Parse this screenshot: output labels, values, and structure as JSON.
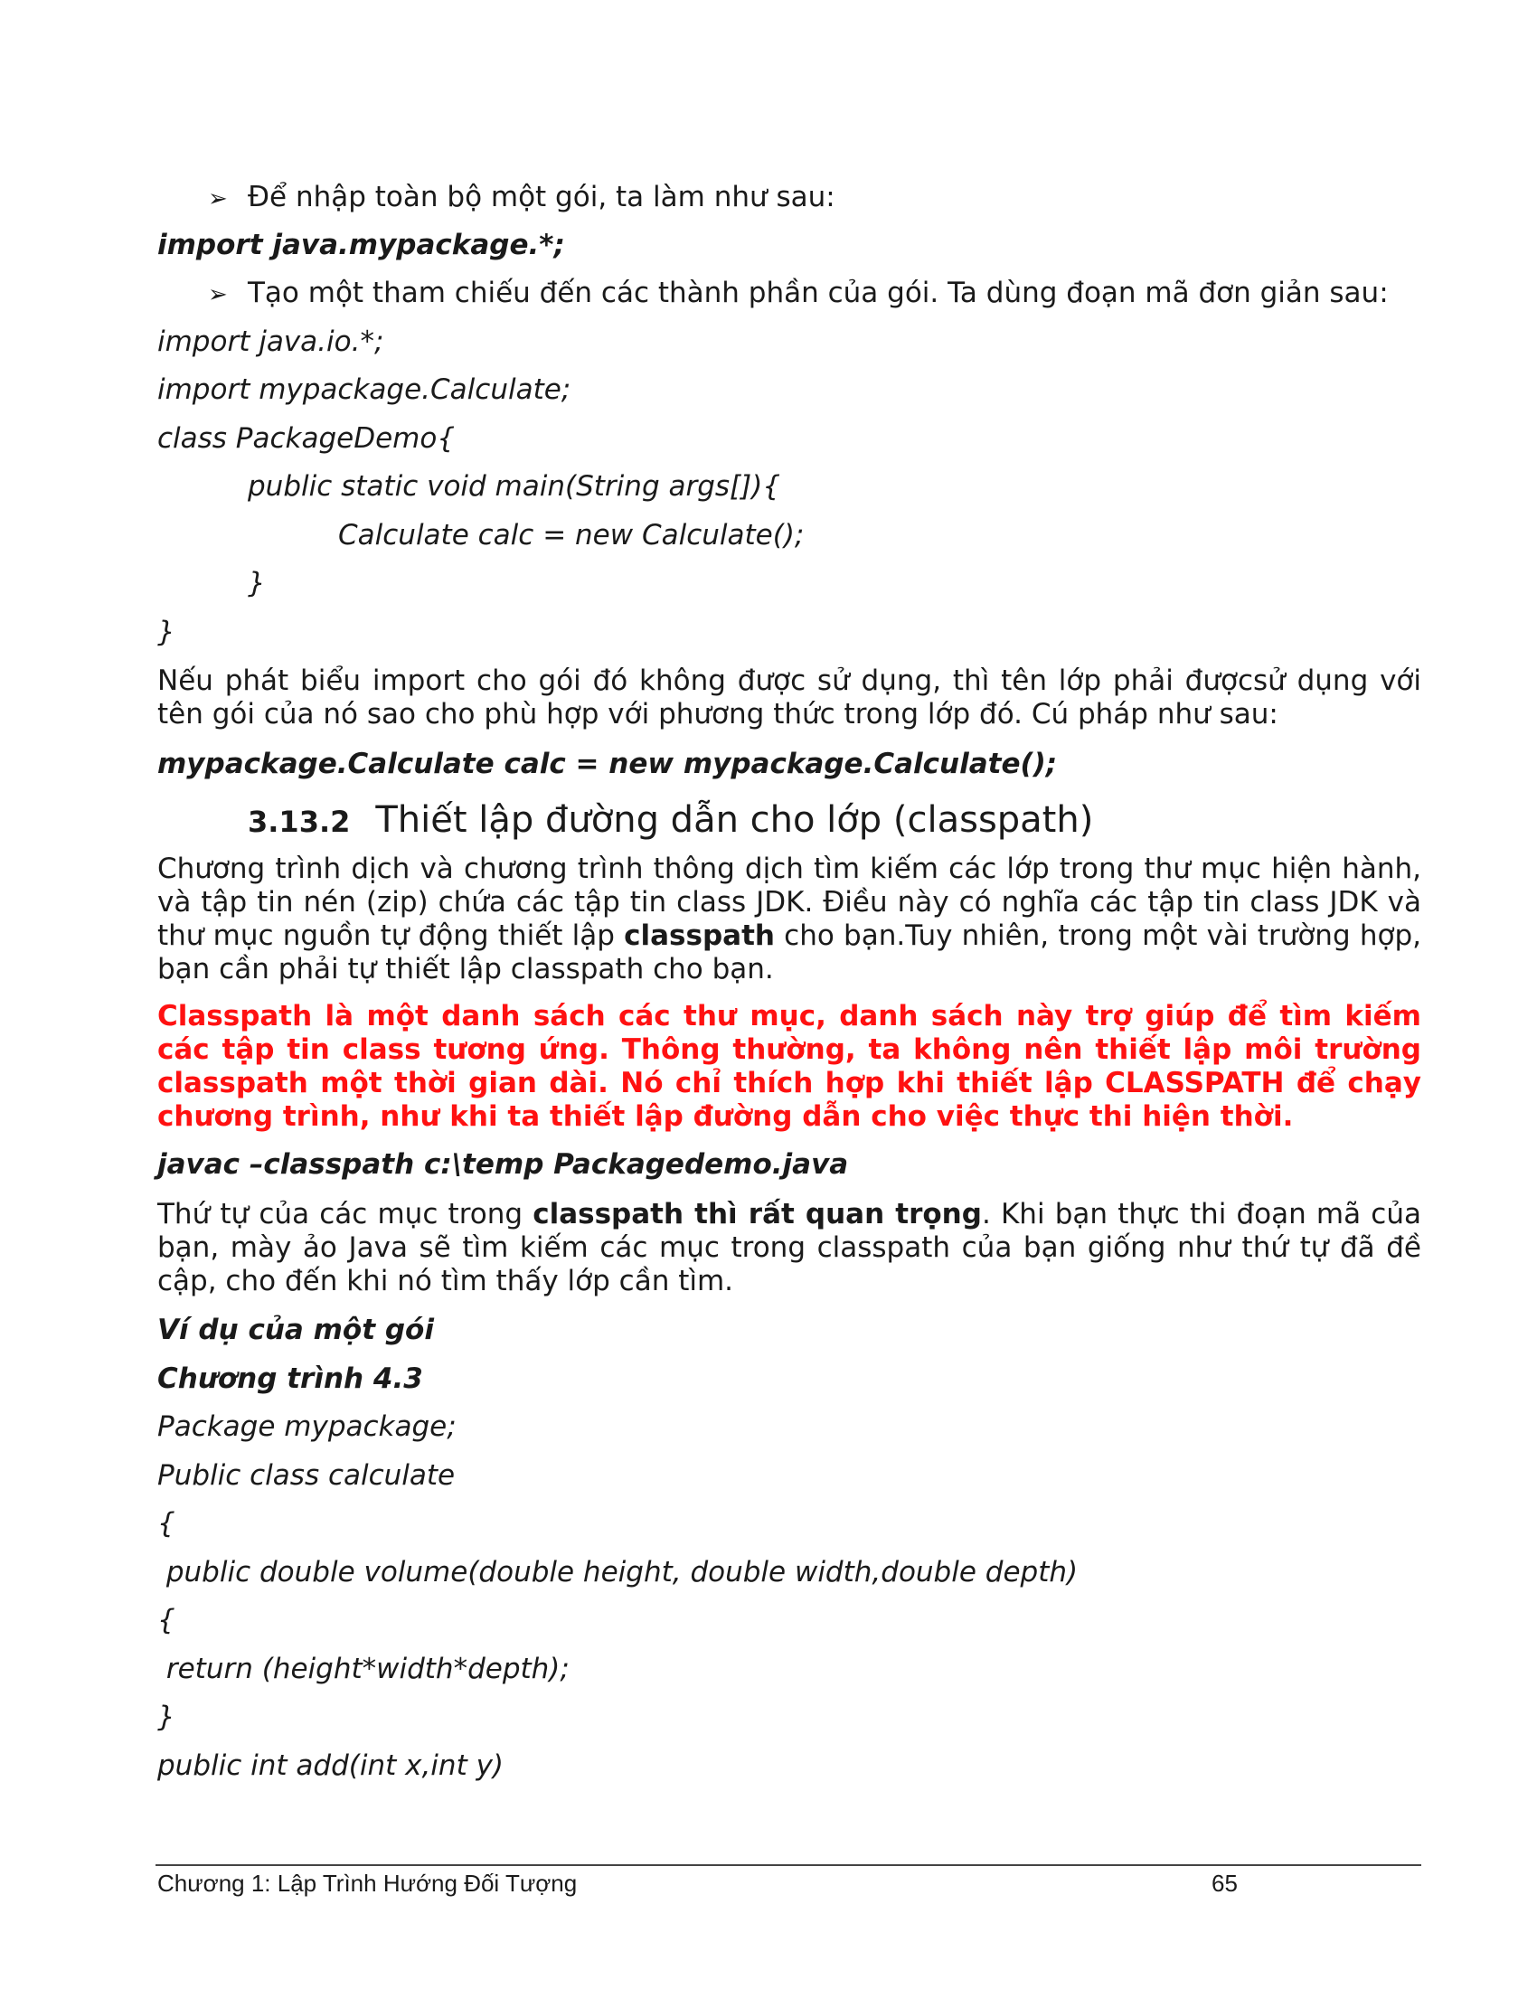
{
  "bullets": {
    "b1": "Để nhập toàn bộ một gói, ta làm như sau:",
    "b2": "Tạo một tham chiếu đến các thành phần của gói. Ta dùng đoạn mã đơn giản sau:",
    "marker": "➢"
  },
  "code1": {
    "import_all": "import java.mypackage.*;",
    "l1": "import java.io.*;",
    "l2": "import mypackage.Calculate;",
    "l3": "class PackageDemo{",
    "l4": "public static void main(String args[]){",
    "l5": "Calculate calc = new Calculate();",
    "l6": "}",
    "l7": "}"
  },
  "para1": "Nếu phát biểu import cho gói đó không được sử dụng, thì tên lớp phải đượcsử dụng với tên gói của nó sao cho phù hợp với phương thức trong lớp đó. Cú pháp như sau:",
  "syntax": "mypackage.Calculate calc = new mypackage.Calculate();",
  "heading": {
    "number": "3.13.2",
    "title": "Thiết lập đường dẫn cho lớp (classpath)"
  },
  "para2": {
    "before": "Chương trình dịch và chương trình thông dịch tìm kiếm các lớp trong thư mục hiện hành, và tập tin nén (zip)  chứa các tập tin class JDK. Điều này có nghĩa các tập tin class JDK và thư mục nguồn tự động thiết lập ",
    "bold": "classpath",
    "after": " cho bạn.Tuy nhiên, trong một vài trường hợp, bạn cần phải tự thiết lập classpath cho bạn."
  },
  "red_para": "Classpath là một danh sách các thư mục, danh sách này trợ giúp để tìm kiếm các tập tin class tương ứng. Thông thường, ta không nên thiết lập môi trường classpath  một thời gian dài. Nó chỉ thích hợp khi thiết lập CLASSPATH để chạy chương trình, như khi ta thiết lập đường dẫn cho việc thực thi hiện thời.",
  "javac_cmd": "javac –classpath   c:\\temp  Packagedemo.java",
  "para3": {
    "before": "Thứ tự của các mục trong ",
    "bold": "classpath thì rất quan trọng",
    "after": ". Khi bạn thực thi đoạn mã của bạn, mày ảo Java sẽ tìm kiếm các mục trong classpath của bạn giống như thứ tự đã đề cập, cho đến khi nó tìm thấy lớp cần tìm."
  },
  "example_title": "Ví dụ của một gói",
  "program_title": "Chương trình 4.3",
  "code2": {
    "l1": "Package mypackage;",
    "l2": "Public class calculate",
    "l3": "{",
    "l4": " public double volume(double height, double width,double depth)",
    "l5": "{",
    "l6": " return (height*width*depth);",
    "l7": "}",
    "l8": "public int add(int x,int y)"
  },
  "footer": {
    "chapter": "Chương 1: Lập Trình Hướng Đối Tượng",
    "page_number": "65"
  }
}
